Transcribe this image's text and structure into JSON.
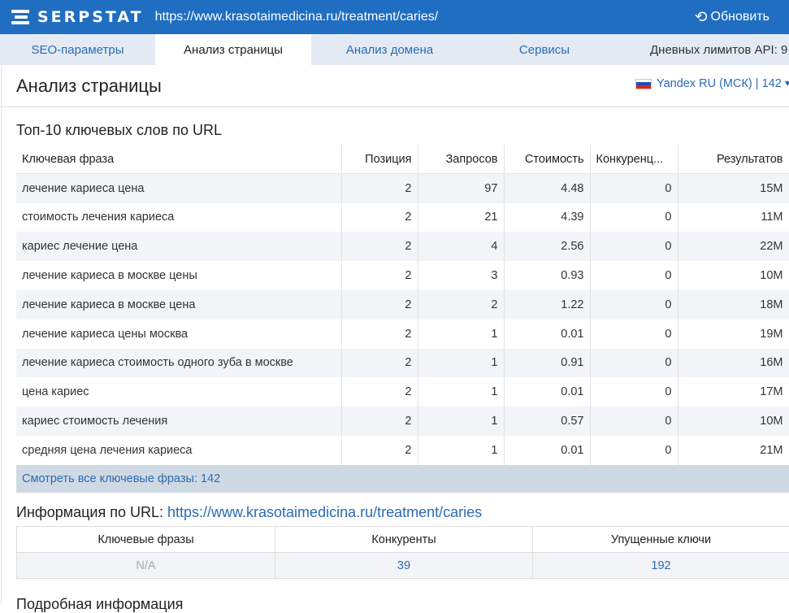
{
  "topbar": {
    "logo_text": "SERPSTAT",
    "url": "https://www.krasotaimedicina.ru/treatment/caries/",
    "refresh_label": "Обновить"
  },
  "tabs": [
    {
      "label": "SEO-параметры"
    },
    {
      "label": "Анализ страницы"
    },
    {
      "label": "Анализ домена"
    },
    {
      "label": "Сервисы"
    }
  ],
  "api_limits_label": "Дневных лимитов API: 9",
  "page": {
    "title": "Анализ страницы",
    "region": "Yandex RU (МСК) | 142"
  },
  "keywords": {
    "title": "Топ-10 ключевых слов по URL",
    "columns": [
      "Ключевая фраза",
      "Позиция",
      "Запросов",
      "Стоимость",
      "Конкуренц...",
      "Результатов"
    ],
    "rows": [
      [
        "лечение кариеса цена",
        "2",
        "97",
        "4.48",
        "0",
        "15M"
      ],
      [
        "стоимость лечения кариеса",
        "2",
        "21",
        "4.39",
        "0",
        "11M"
      ],
      [
        "кариес лечение цена",
        "2",
        "4",
        "2.56",
        "0",
        "22M"
      ],
      [
        "лечение кариеса в москве цены",
        "2",
        "3",
        "0.93",
        "0",
        "10M"
      ],
      [
        "лечение кариеса в москве цена",
        "2",
        "2",
        "1.22",
        "0",
        "18M"
      ],
      [
        "лечение кариеса цены москва",
        "2",
        "1",
        "0.01",
        "0",
        "19M"
      ],
      [
        "лечение кариеса стоимость одного зуба в москве",
        "2",
        "1",
        "0.91",
        "0",
        "16M"
      ],
      [
        "цена кариес",
        "2",
        "1",
        "0.01",
        "0",
        "17M"
      ],
      [
        "кариес стоимость лечения",
        "2",
        "1",
        "0.57",
        "0",
        "10M"
      ],
      [
        "средняя цена лечения кариеса",
        "2",
        "1",
        "0.01",
        "0",
        "21M"
      ]
    ],
    "more_link": "Смотреть все ключевые фразы: 142"
  },
  "url_info": {
    "title_prefix": "Информация по URL:",
    "title_link": "https://www.krasotaimedicina.ru/treatment/caries",
    "columns": [
      "Ключевые фразы",
      "Конкуренты",
      "Упущенные ключи"
    ],
    "values": [
      "N/A",
      "39",
      "192"
    ]
  },
  "next_section_title": "Подробная информация",
  "colors": {
    "brand_blue": "#1f6ec1",
    "link_blue": "#2b6bb2"
  }
}
